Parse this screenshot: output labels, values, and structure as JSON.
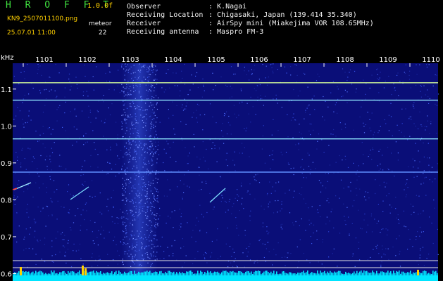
{
  "header": {
    "app_title": "H R O F F T",
    "version": "1.0.0f",
    "filename": "KN9_2507011100.png",
    "timestamp": "25.07.01 11:00",
    "meteor_label": "meteor",
    "meteor_count": "22",
    "info": [
      {
        "label": "Observer",
        "value": ": K.Nagai"
      },
      {
        "label": "Receiving Location",
        "value": ": Chigasaki, Japan (139.414 35.340)"
      },
      {
        "label": "Receiver",
        "value": ": AirSpy mini (Miakejima VOR 108.65MHz)"
      },
      {
        "label": "Receiving antenna",
        "value": ": Maspro FM-3"
      }
    ]
  },
  "spectrogram": {
    "y_unit": "kHz",
    "x_ticks": [
      "1101",
      "1102",
      "1103",
      "1104",
      "1105",
      "1106",
      "1107",
      "1108",
      "1109",
      "1110"
    ],
    "y_ticks": [
      {
        "label": "1.1",
        "value": 1.1
      },
      {
        "label": "1.0",
        "value": 1.0
      },
      {
        "label": "0.9",
        "value": 0.9
      },
      {
        "label": "0.8",
        "value": 0.8
      },
      {
        "label": "0.7",
        "value": 0.7
      },
      {
        "label": "0.6",
        "value": 0.6
      }
    ],
    "y_range": [
      0.58,
      1.17
    ],
    "carrier_lines_khz": [
      {
        "value": 1.117,
        "color": "#d6ff9a"
      },
      {
        "value": 1.07,
        "color": "#8fe8ff"
      },
      {
        "value": 0.965,
        "color": "#8fe8ff"
      },
      {
        "value": 0.875,
        "color": "#5f8fff"
      }
    ],
    "colors": {
      "background": "#0a0e78",
      "noise_band": "#3050d8",
      "level_band": "#00e5ff",
      "spike": "#ffd000"
    }
  }
}
